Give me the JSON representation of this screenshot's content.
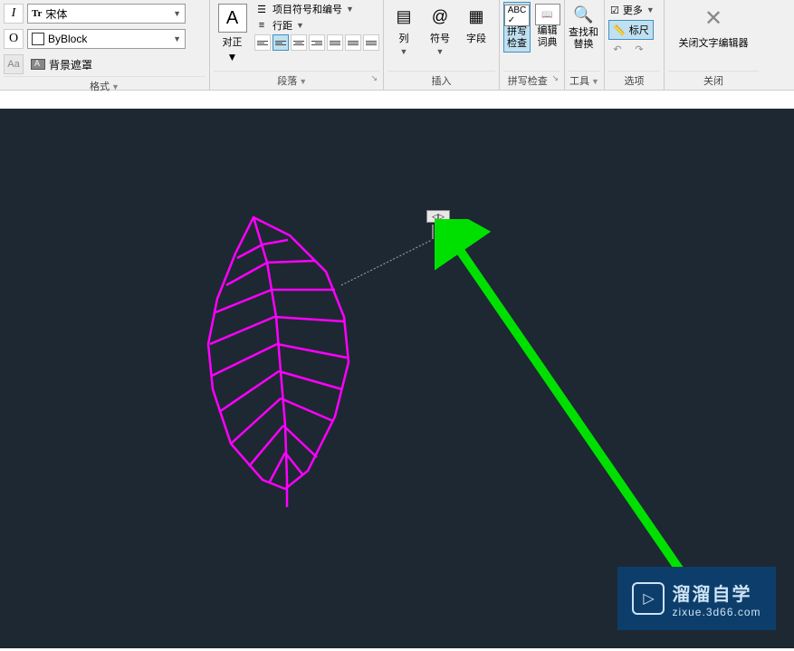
{
  "ribbon": {
    "format": {
      "title": "格式",
      "italic": "I",
      "overline": "O",
      "annotation": "Aa",
      "font": "宋体",
      "color": "ByBlock",
      "bgMask": "背景遮罩"
    },
    "paragraph": {
      "title": "段落",
      "justify": "对正",
      "bullets": "项目符号和编号",
      "lineSpacing": "行距"
    },
    "insert": {
      "title": "插入",
      "columns": "列",
      "symbol": "符号",
      "field": "字段"
    },
    "spellCheck": {
      "title": "拼写检查",
      "spellCheck": "拼写\n检查",
      "editDict": "编辑\n词典"
    },
    "tools": {
      "title": "工具",
      "findReplace": "查找和\n替换"
    },
    "options": {
      "title": "选项",
      "more": "更多",
      "ruler": "标尺"
    },
    "close": {
      "title": "关闭",
      "closeEditor": "关闭文字编辑器"
    }
  },
  "logo": {
    "cn": "溜溜自学",
    "en": "zixue.3d66.com"
  }
}
